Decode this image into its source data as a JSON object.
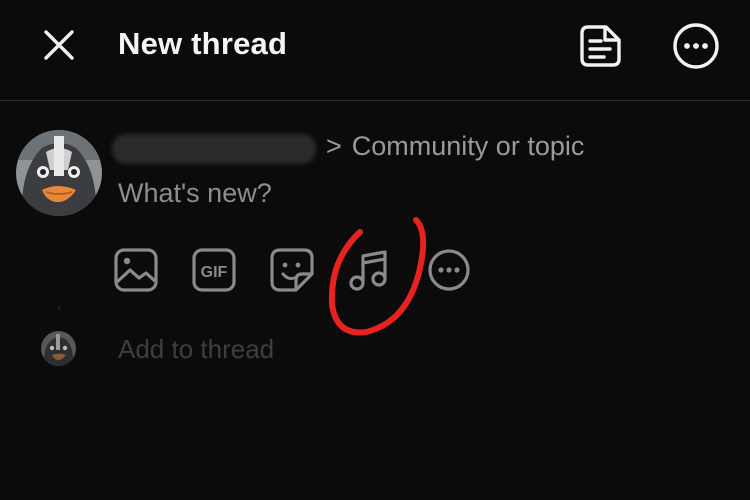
{
  "header": {
    "close_icon": "close-icon",
    "title": "New thread",
    "drafts_icon": "drafts-icon",
    "more_icon": "more-options-icon"
  },
  "composer": {
    "avatar": "penguin-avatar",
    "topic_chevron": ">",
    "topic_placeholder": "Community or topic",
    "body_placeholder": "What's new?",
    "attachments": [
      {
        "name": "image",
        "icon": "image-icon"
      },
      {
        "name": "gif",
        "icon": "gif-icon",
        "label": "GIF"
      },
      {
        "name": "sticker",
        "icon": "sticker-icon"
      },
      {
        "name": "music",
        "icon": "music-note-icon"
      },
      {
        "name": "more",
        "icon": "more-icon"
      }
    ],
    "annotation_color": "#e8231f"
  },
  "add_thread": {
    "placeholder": "Add to thread"
  },
  "colors": {
    "background": "#0b0b0b",
    "title": "#f5f5f5",
    "placeholder": "#8d8d8d",
    "icon": "#8a8a8a",
    "annotation": "#e8231f"
  }
}
